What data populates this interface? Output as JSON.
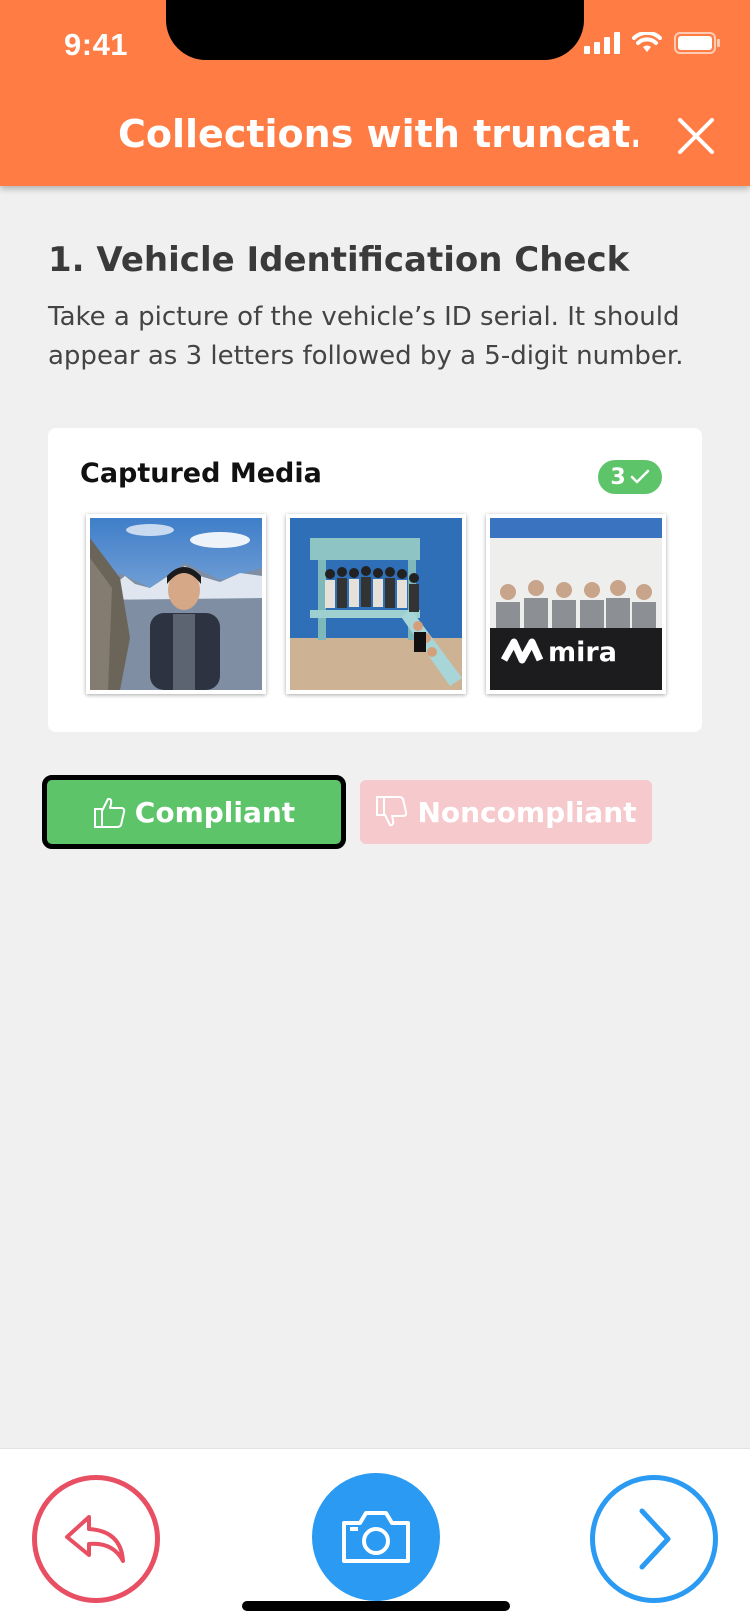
{
  "status_bar": {
    "time": "9:41"
  },
  "header": {
    "title": "Collections with truncat…"
  },
  "question": {
    "title": "1. Vehicle Identification Check",
    "description": "Take a picture of the vehicle’s ID serial. It should appear as 3 letters followed by a 5-digit number."
  },
  "media": {
    "title": "Captured Media",
    "count": "3",
    "logo_text": "mira"
  },
  "buttons": {
    "compliant": "Compliant",
    "noncompliant": "Noncompliant"
  },
  "colors": {
    "header": "#ff7d45",
    "compliant": "#5ec46a",
    "noncompliant": "#f6c9cd",
    "back": "#e84f62",
    "primary": "#2a9af2"
  }
}
